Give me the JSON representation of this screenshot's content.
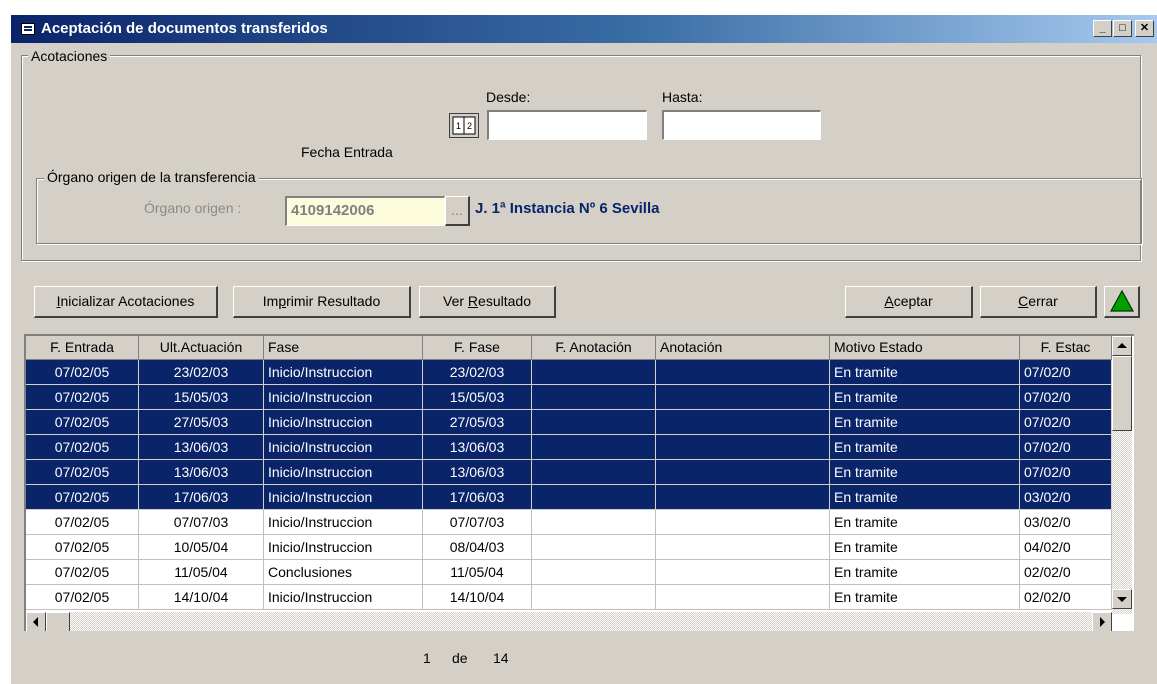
{
  "window": {
    "title": "Aceptación de documentos transferidos",
    "minimize": "_",
    "maximize": "□",
    "close": "✕"
  },
  "acotaciones": {
    "legend": "Acotaciones",
    "desde_label": "Desde:",
    "hasta_label": "Hasta:",
    "fecha_entrada_label": "Fecha Entrada",
    "desde_value": "",
    "hasta_value": ""
  },
  "organo": {
    "legend": "Órgano origen de la transferencia",
    "label": "Órgano origen :",
    "value": "4109142006",
    "browse": "...",
    "description": "J. 1ª Instancia  Nº 6 Sevilla"
  },
  "buttons": {
    "inicializar_pre": "I",
    "inicializar_post": "nicializar Acotaciones",
    "imprimir_pre": "Im",
    "imprimir_ul": "p",
    "imprimir_post": "rimir Resultado",
    "ver_pre": "Ver ",
    "ver_ul": "R",
    "ver_post": "esultado",
    "aceptar_ul": "A",
    "aceptar_post": "ceptar",
    "cerrar_ul": "C",
    "cerrar_post": "errar"
  },
  "colors": {
    "selection": "#0a246a",
    "up_icon": "#00a000"
  },
  "grid": {
    "headers": [
      "F. Entrada",
      "Ult.Actuación",
      "Fase",
      "F. Fase",
      "F. Anotación",
      "Anotación",
      "Motivo Estado",
      "F. Estac"
    ],
    "rows": [
      {
        "c0": "07/02/05",
        "c1": "23/02/03",
        "c2": "Inicio/Instruccion",
        "c3": "23/02/03",
        "c4": "",
        "c5": "",
        "c6": "En tramite",
        "c7": "07/02/0"
      },
      {
        "c0": "07/02/05",
        "c1": "15/05/03",
        "c2": "Inicio/Instruccion",
        "c3": "15/05/03",
        "c4": "",
        "c5": "",
        "c6": "En tramite",
        "c7": "07/02/0"
      },
      {
        "c0": "07/02/05",
        "c1": "27/05/03",
        "c2": "Inicio/Instruccion",
        "c3": "27/05/03",
        "c4": "",
        "c5": "",
        "c6": "En tramite",
        "c7": "07/02/0"
      },
      {
        "c0": "07/02/05",
        "c1": "13/06/03",
        "c2": "Inicio/Instruccion",
        "c3": "13/06/03",
        "c4": "",
        "c5": "",
        "c6": "En tramite",
        "c7": "07/02/0"
      },
      {
        "c0": "07/02/05",
        "c1": "13/06/03",
        "c2": "Inicio/Instruccion",
        "c3": "13/06/03",
        "c4": "",
        "c5": "",
        "c6": "En tramite",
        "c7": "07/02/0"
      },
      {
        "c0": "07/02/05",
        "c1": "17/06/03",
        "c2": "Inicio/Instruccion",
        "c3": "17/06/03",
        "c4": "",
        "c5": "",
        "c6": "En tramite",
        "c7": "03/02/0"
      },
      {
        "c0": "07/02/05",
        "c1": "07/07/03",
        "c2": "Inicio/Instruccion",
        "c3": "07/07/03",
        "c4": "",
        "c5": "",
        "c6": "En tramite",
        "c7": "03/02/0"
      },
      {
        "c0": "07/02/05",
        "c1": "10/05/04",
        "c2": "Inicio/Instruccion",
        "c3": "08/04/03",
        "c4": "",
        "c5": "",
        "c6": "En tramite",
        "c7": "04/02/0"
      },
      {
        "c0": "07/02/05",
        "c1": "11/05/04",
        "c2": "Conclusiones",
        "c3": "11/05/04",
        "c4": "",
        "c5": "",
        "c6": "En tramite",
        "c7": "02/02/0"
      },
      {
        "c0": "07/02/05",
        "c1": "14/10/04",
        "c2": "Inicio/Instruccion",
        "c3": "14/10/04",
        "c4": "",
        "c5": "",
        "c6": "En tramite",
        "c7": "02/02/0"
      }
    ]
  },
  "pagination": {
    "current": "1",
    "of": "de",
    "total": "14"
  }
}
